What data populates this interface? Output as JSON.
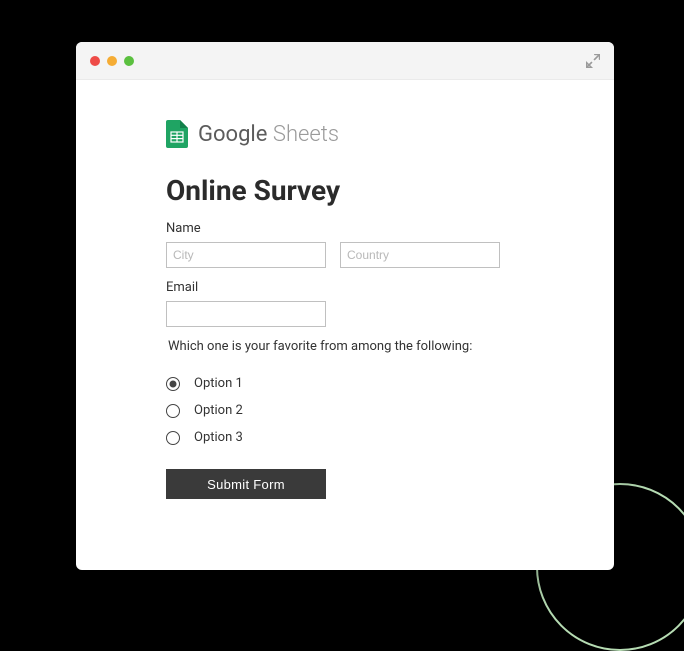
{
  "brand": {
    "name_bold": "Google",
    "name_light": "Sheets"
  },
  "form": {
    "title": "Online Survey",
    "name_label": "Name",
    "city_placeholder": "City",
    "country_placeholder": "Country",
    "email_label": "Email",
    "question": "Which one is your favorite from among the following:",
    "options": [
      "Option 1",
      "Option 2",
      "Option 3"
    ],
    "selected_index": 0,
    "submit_label": "Submit Form"
  }
}
